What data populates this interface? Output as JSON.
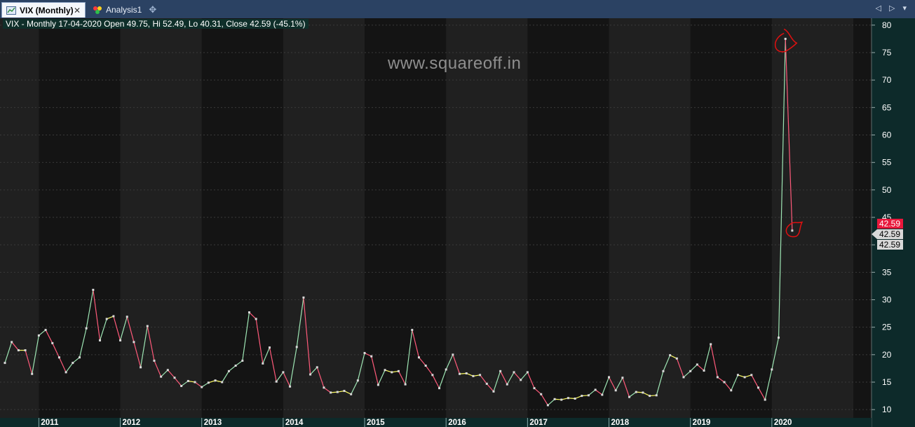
{
  "tabs": [
    {
      "label": "VIX (Monthly)",
      "active": true,
      "close_icon": "close-icon"
    },
    {
      "label": "Analysis1",
      "active": false
    }
  ],
  "add_tab_icon": "add-tab-icon",
  "nav_arrows": "◁ ▷ ▾",
  "info_bar": "VIX - Monthly 17-04-2020 Open 49.75, Hi 52.49, Lo 40.31, Close 42.59 (-45.1%)",
  "watermark": "www.squareoff.in",
  "price_tags": [
    "42.59",
    "42.59",
    "42.59"
  ],
  "colors": {
    "up": "#9ee6b4",
    "down": "#ff5a7a",
    "flat": "#ffff66",
    "alt_band_light": "#202020",
    "alt_band_dark": "#141414",
    "axis_bg": "#0d2a2a",
    "tag_red": "#e8183c",
    "tag_grey": "#d8d8d8",
    "annotation": "#e01010"
  },
  "chart_data": {
    "type": "line",
    "title": "VIX - Monthly",
    "ylim": [
      9,
      81
    ],
    "yticks": [
      10,
      15,
      20,
      25,
      30,
      35,
      40,
      45,
      50,
      55,
      60,
      65,
      70,
      75,
      80
    ],
    "year_labels": [
      "2011",
      "2012",
      "2013",
      "2014",
      "2015",
      "2016",
      "2017",
      "2018",
      "2019",
      "2020"
    ],
    "start": "2010-08",
    "values": [
      18.5,
      22.3,
      20.8,
      20.8,
      16.5,
      23.5,
      24.5,
      22.1,
      19.5,
      16.8,
      18.5,
      19.5,
      24.8,
      31.8,
      22.6,
      26.5,
      27.0,
      22.6,
      26.9,
      22.3,
      17.7,
      25.2,
      18.9,
      16.0,
      17.2,
      15.8,
      14.3,
      15.2,
      15.0,
      14.1,
      14.9,
      15.3,
      15.0,
      17.0,
      18.0,
      18.9,
      27.7,
      26.5,
      18.4,
      21.3,
      15.1,
      16.8,
      14.2,
      21.4,
      30.4,
      16.4,
      17.7,
      14.0,
      13.1,
      13.2,
      13.4,
      12.8,
      15.3,
      20.3,
      19.7,
      14.5,
      17.2,
      16.8,
      17.0,
      14.6,
      24.5,
      19.5,
      18.0,
      16.3,
      13.9,
      17.3,
      20.0,
      16.5,
      16.6,
      16.1,
      16.3,
      14.7,
      13.3,
      17.0,
      14.6,
      16.8,
      15.4,
      16.8,
      13.9,
      12.8,
      10.8,
      11.9,
      11.8,
      12.1,
      12.0,
      12.5,
      12.6,
      13.6,
      12.7,
      15.9,
      13.5,
      15.8,
      12.3,
      13.2,
      13.1,
      12.5,
      12.6,
      17.0,
      19.9,
      19.3,
      15.9,
      17.0,
      18.2,
      17.1,
      21.9,
      15.9,
      15.0,
      13.5,
      16.3,
      15.9,
      16.3,
      14.0,
      11.8,
      17.3,
      23.1,
      77.5,
      42.59
    ],
    "highlight_points": [
      {
        "value": 77.5,
        "label": "peak"
      },
      {
        "value": 42.59,
        "label": "last close"
      }
    ]
  }
}
